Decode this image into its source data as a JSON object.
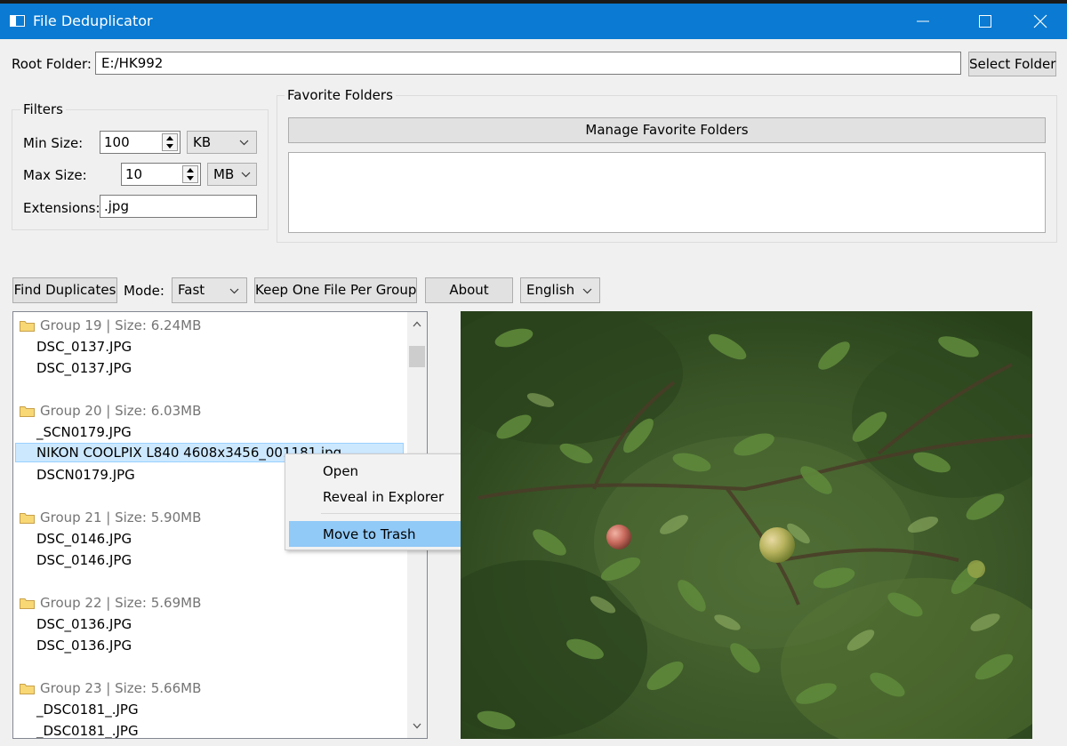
{
  "window": {
    "title": "File Deduplicator"
  },
  "root": {
    "label": "Root Folder:",
    "path": "E:/HK992",
    "select_button": "Select Folder"
  },
  "filters": {
    "title": "Filters",
    "min_label": "Min Size:",
    "min_value": "100",
    "min_unit": "KB",
    "max_label": "Max Size:",
    "max_value": "10",
    "max_unit": "MB",
    "ext_label": "Extensions:",
    "ext_value": ".jpg"
  },
  "favorites": {
    "title": "Favorite Folders",
    "manage_button": "Manage Favorite Folders"
  },
  "toolbar": {
    "find_button": "Find Duplicates",
    "mode_label": "Mode:",
    "mode_value": "Fast",
    "keep_button": "Keep One File Per Group",
    "about_button": "About",
    "language_value": "English"
  },
  "groups": [
    {
      "header": "Group 19 | Size: 6.24MB",
      "files": [
        "DSC_0137.JPG",
        "DSC_0137.JPG"
      ]
    },
    {
      "header": "Group 20 | Size: 6.03MB",
      "files": [
        "_SCN0179.JPG",
        "NIKON COOLPIX L840 4608x3456_001181.jpg",
        "DSCN0179.JPG"
      ]
    },
    {
      "header": "Group 21 | Size: 5.90MB",
      "files": [
        "DSC_0146.JPG",
        "DSC_0146.JPG"
      ]
    },
    {
      "header": "Group 22 | Size: 5.69MB",
      "files": [
        "DSC_0136.JPG",
        "DSC_0136.JPG"
      ]
    },
    {
      "header": "Group 23 | Size: 5.66MB",
      "files": [
        "_DSC0181_.JPG",
        "_DSC0181_.JPG"
      ]
    }
  ],
  "context_menu": {
    "open": "Open",
    "reveal": "Reveal in Explorer",
    "trash": "Move to Trash"
  },
  "icons": {
    "folder": "folder-icon",
    "minimize": "minimize-icon",
    "maximize": "maximize-icon",
    "close": "close-icon",
    "chevron": "chevron-down-icon",
    "spin": "spin-arrows-icon"
  },
  "colors": {
    "titlebar": "#0a7ad2",
    "selection": "#cce8ff",
    "menu_highlight": "#91c9f7"
  }
}
